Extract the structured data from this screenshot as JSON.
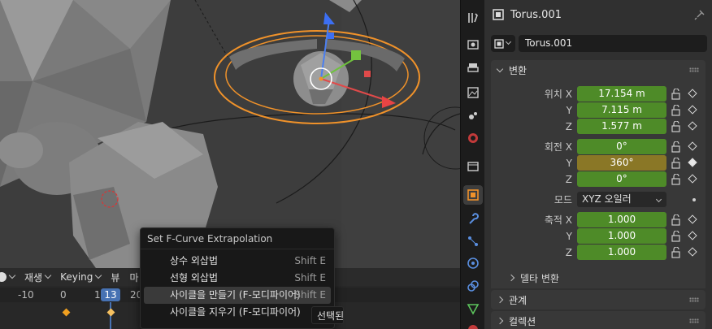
{
  "timeline": {
    "playback_label": "재생",
    "keying_label": "Keying",
    "view_label": "뷰",
    "marker_label": "마",
    "ticks": [
      "-10",
      "0",
      "1",
      "20"
    ],
    "current_frame": "13"
  },
  "context_menu": {
    "title": "Set F-Curve Extrapolation",
    "items": [
      {
        "label": "상수 외삽법",
        "shortcut": "Shift E"
      },
      {
        "label": "선형 외삽법",
        "shortcut": "Shift E"
      },
      {
        "label": "사이클을 만들기 (F-모디파이어)",
        "shortcut": "Shift E"
      },
      {
        "label": "사이클을 지우기 (F-모디파이어)",
        "shortcut": "Sl"
      }
    ],
    "tooltip": "선택된"
  },
  "properties": {
    "object_name": "Torus.001",
    "name_field": "Torus.001",
    "transform": {
      "header": "변환",
      "location_label": "위치 X",
      "location": [
        "17.154 m",
        "7.115 m",
        "1.577 m"
      ],
      "rotation_label": "회전 X",
      "rotation": [
        "0°",
        "360°",
        "0°"
      ],
      "axis_y": "Y",
      "axis_z": "Z",
      "mode_label": "모드",
      "mode_value": "XYZ 오일러",
      "scale_label": "축적 X",
      "scale": [
        "1.000",
        "1.000",
        "1.000"
      ],
      "delta_label": "델타 변환"
    },
    "relations_label": "관계",
    "collections_label": "컬렉션"
  },
  "colors": {
    "viewport_bg": "#3d3d3d",
    "selection_orange": "#f0922a",
    "field_green": "#4e8b28",
    "field_yellow": "#8a7726",
    "frame_blue": "#4772b3"
  }
}
